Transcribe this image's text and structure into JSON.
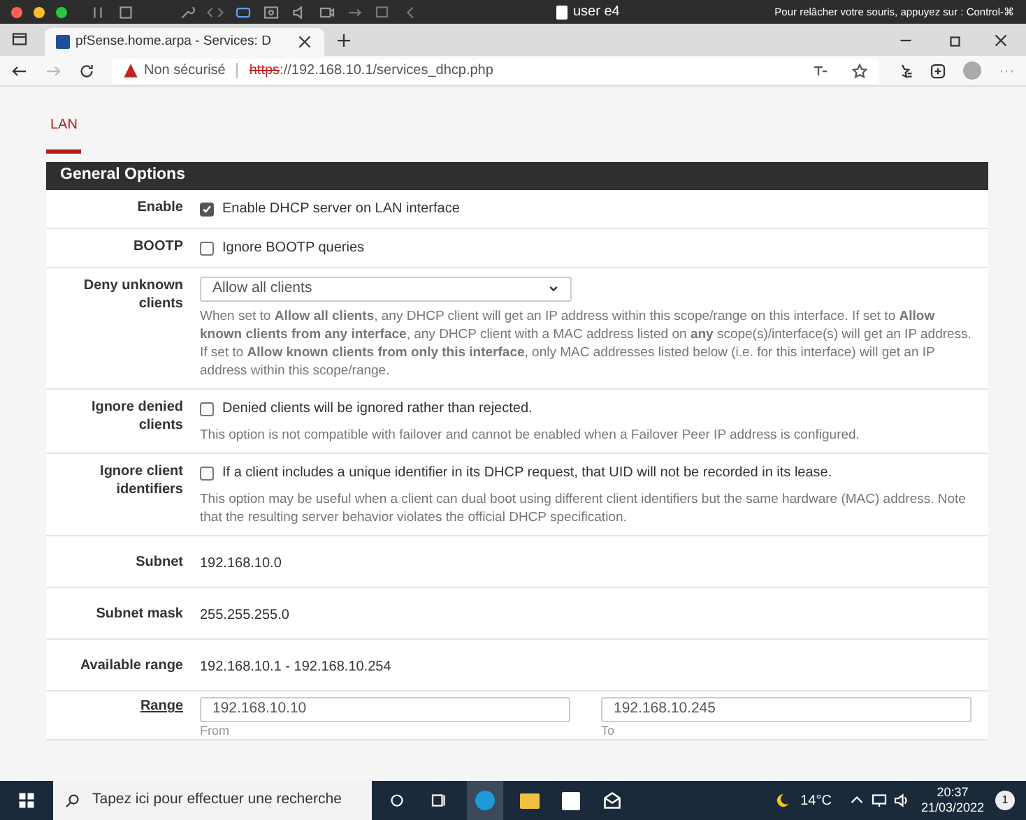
{
  "vm_bar": {
    "user": "user e4",
    "hint": "Pour relâcher votre souris, appuyez sur : Control-⌘"
  },
  "browser": {
    "tab_title": "pfSense.home.arpa - Services: D",
    "security": "Non sécurisé",
    "url_scheme": "https",
    "url_rest": "://192.168.10.1/services_dhcp.php"
  },
  "interface_tabs": [
    {
      "label": "LAN",
      "selected": true
    }
  ],
  "section": {
    "title": "General Options"
  },
  "rows": [
    {
      "kind": "checkbox",
      "label": "Enable",
      "checked": true,
      "text": "Enable DHCP server on LAN interface"
    },
    {
      "kind": "checkbox",
      "label": "BOOTP",
      "checked": false,
      "text": "Ignore BOOTP queries"
    },
    {
      "kind": "select",
      "label": "Deny unknown clients",
      "value": "Allow all clients",
      "help": "When set to **Allow all clients**, any DHCP client will get an IP address within this scope/range on this interface. If set to **Allow known clients from any interface**, any DHCP client with a MAC address listed on **any** scope(s)/interface(s) will get an IP address. If set to **Allow known clients from only this interface**, only MAC addresses listed below (i.e. for this interface) will get an IP address within this scope/range."
    },
    {
      "kind": "checkbox",
      "label": "Ignore denied clients",
      "checked": false,
      "text": "Denied clients will be ignored rather than rejected.",
      "help": "This option is not compatible with failover and cannot be enabled when a Failover Peer IP address is configured."
    },
    {
      "kind": "checkbox",
      "label": "Ignore client identifiers",
      "checked": false,
      "text": "If a client includes a unique identifier in its DHCP request, that UID will not be recorded in its lease.",
      "help": "This option may be useful when a client can dual boot using different client identifiers but the same hardware (MAC) address. Note that the resulting server behavior violates the official DHCP specification."
    },
    {
      "kind": "static",
      "label": "Subnet",
      "value": "192.168.10.0"
    },
    {
      "kind": "static",
      "label": "Subnet mask",
      "value": "255.255.255.0"
    },
    {
      "kind": "static",
      "label": "Available range",
      "value": "192.168.10.1 - 192.168.10.254"
    },
    {
      "kind": "range",
      "label": "Range",
      "from": "192.168.10.10",
      "from_label": "From",
      "to": "192.168.10.245",
      "to_label": "To"
    }
  ],
  "taskbar": {
    "search_placeholder": "Tapez ici pour effectuer une recherche",
    "weather": "14°C",
    "time": "20:37",
    "date": "21/03/2022",
    "notifications": "1"
  }
}
